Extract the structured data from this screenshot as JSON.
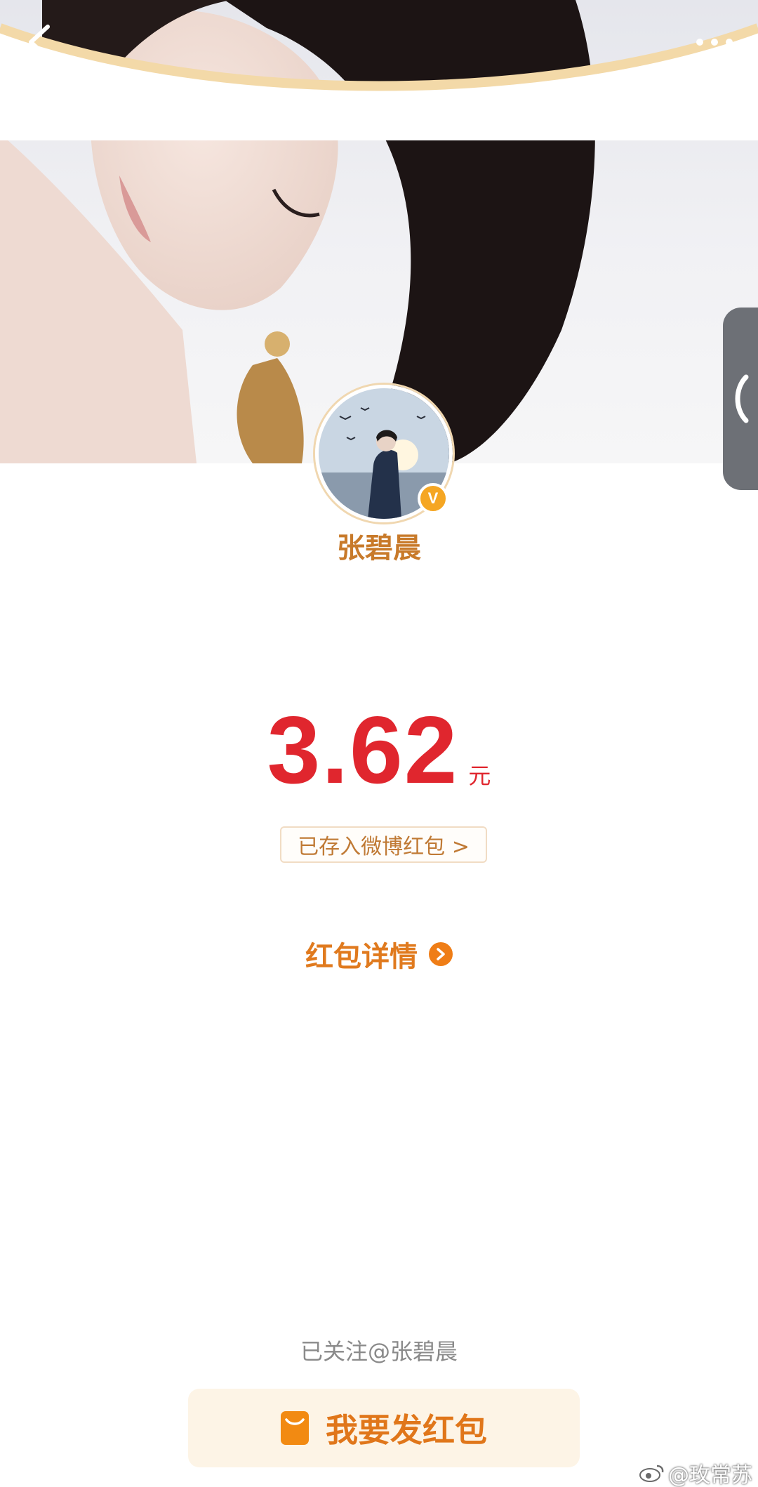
{
  "topbar": {
    "back_icon": "chevron-left-icon",
    "more_icon": "more-horizontal-icon",
    "side_handle_icon": "chevron-left-icon"
  },
  "sender": {
    "name": "张碧晨",
    "verified_badge": "V"
  },
  "redpacket": {
    "amount": "3.62",
    "unit": "元",
    "saved_link": "已存入微博红包 >",
    "detail_link": "红包详情"
  },
  "footer": {
    "followed_text": "已关注@张碧晨",
    "send_button": "我要发红包",
    "watermark": "@玫常苏"
  },
  "colors": {
    "amount": "#e0262e",
    "accent_orange": "#e0761a",
    "name_gold": "#c87a2a",
    "curve_gold": "#f3d9a8"
  }
}
